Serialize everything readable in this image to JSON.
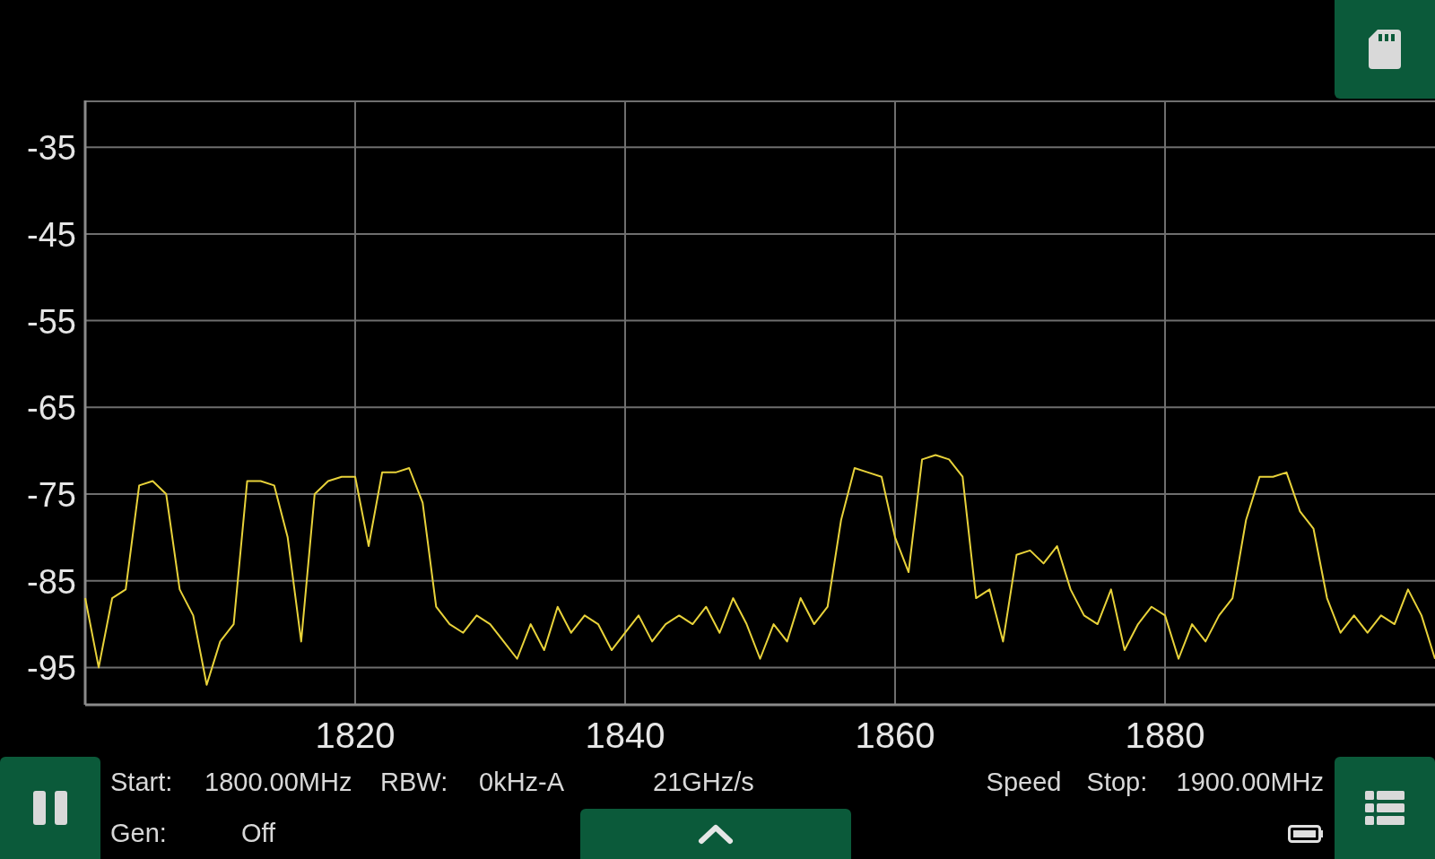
{
  "chart": {
    "chart_data": {
      "type": "line",
      "grid": true,
      "xlim": [
        1800,
        1900
      ],
      "ylim": [
        -99.3,
        -29.6
      ],
      "xticks": [
        1820,
        1840,
        1860,
        1880
      ],
      "yticks": [
        -35,
        -45,
        -55,
        -65,
        -75,
        -85,
        -95
      ],
      "x": [
        1800,
        1801,
        1802,
        1803,
        1804,
        1805,
        1806,
        1807,
        1808,
        1809,
        1810,
        1811,
        1812,
        1813,
        1814,
        1815,
        1816,
        1817,
        1818,
        1819,
        1820,
        1821,
        1822,
        1823,
        1824,
        1825,
        1826,
        1827,
        1828,
        1829,
        1830,
        1831,
        1832,
        1833,
        1834,
        1835,
        1836,
        1837,
        1838,
        1839,
        1840,
        1841,
        1842,
        1843,
        1844,
        1845,
        1846,
        1847,
        1848,
        1849,
        1850,
        1851,
        1852,
        1853,
        1854,
        1855,
        1856,
        1857,
        1858,
        1859,
        1860,
        1861,
        1862,
        1863,
        1864,
        1865,
        1866,
        1867,
        1868,
        1869,
        1870,
        1871,
        1872,
        1873,
        1874,
        1875,
        1876,
        1877,
        1878,
        1879,
        1880,
        1881,
        1882,
        1883,
        1884,
        1885,
        1886,
        1887,
        1888,
        1889,
        1890,
        1891,
        1892,
        1893,
        1894,
        1895,
        1896,
        1897,
        1898,
        1899,
        1900
      ],
      "series": [
        {
          "color": "#e8d23a",
          "values": [
            -87,
            -95,
            -87,
            -86,
            -74,
            -73.5,
            -75,
            -86,
            -89,
            -97,
            -92,
            -90,
            -73.5,
            -73.5,
            -74,
            -80,
            -92,
            -75,
            -73.5,
            -73,
            -73,
            -81,
            -72.5,
            -72.5,
            -72,
            -76,
            -88,
            -90,
            -91,
            -89,
            -90,
            -92,
            -94,
            -90,
            -93,
            -88,
            -91,
            -89,
            -90,
            -93,
            -91,
            -89,
            -92,
            -90,
            -89,
            -90,
            -88,
            -91,
            -87,
            -90,
            -94,
            -90,
            -92,
            -87,
            -90,
            -88,
            -78,
            -72,
            -72.5,
            -73,
            -80,
            -84,
            -71,
            -70.5,
            -71,
            -73,
            -87,
            -86,
            -92,
            -82,
            -81.5,
            -83,
            -81,
            -86,
            -89,
            -90,
            -86,
            -93,
            -90,
            -88,
            -89,
            -94,
            -90,
            -92,
            -89,
            -87,
            -78,
            -73,
            -73,
            -72.5,
            -77,
            -79,
            -87,
            -91,
            -89,
            -91,
            -89,
            -90,
            -86,
            -89,
            -94
          ]
        }
      ]
    }
  },
  "status": {
    "start_label": "Start:",
    "start": "1800.00MHz",
    "rbw_label": "RBW:",
    "rbw": "0kHz-A",
    "sweep": "21GHz/s",
    "speed_label": "Speed",
    "stop_label": "Stop:",
    "stop": "1900.00MHz",
    "gen_label": "Gen:",
    "gen": "Off"
  }
}
